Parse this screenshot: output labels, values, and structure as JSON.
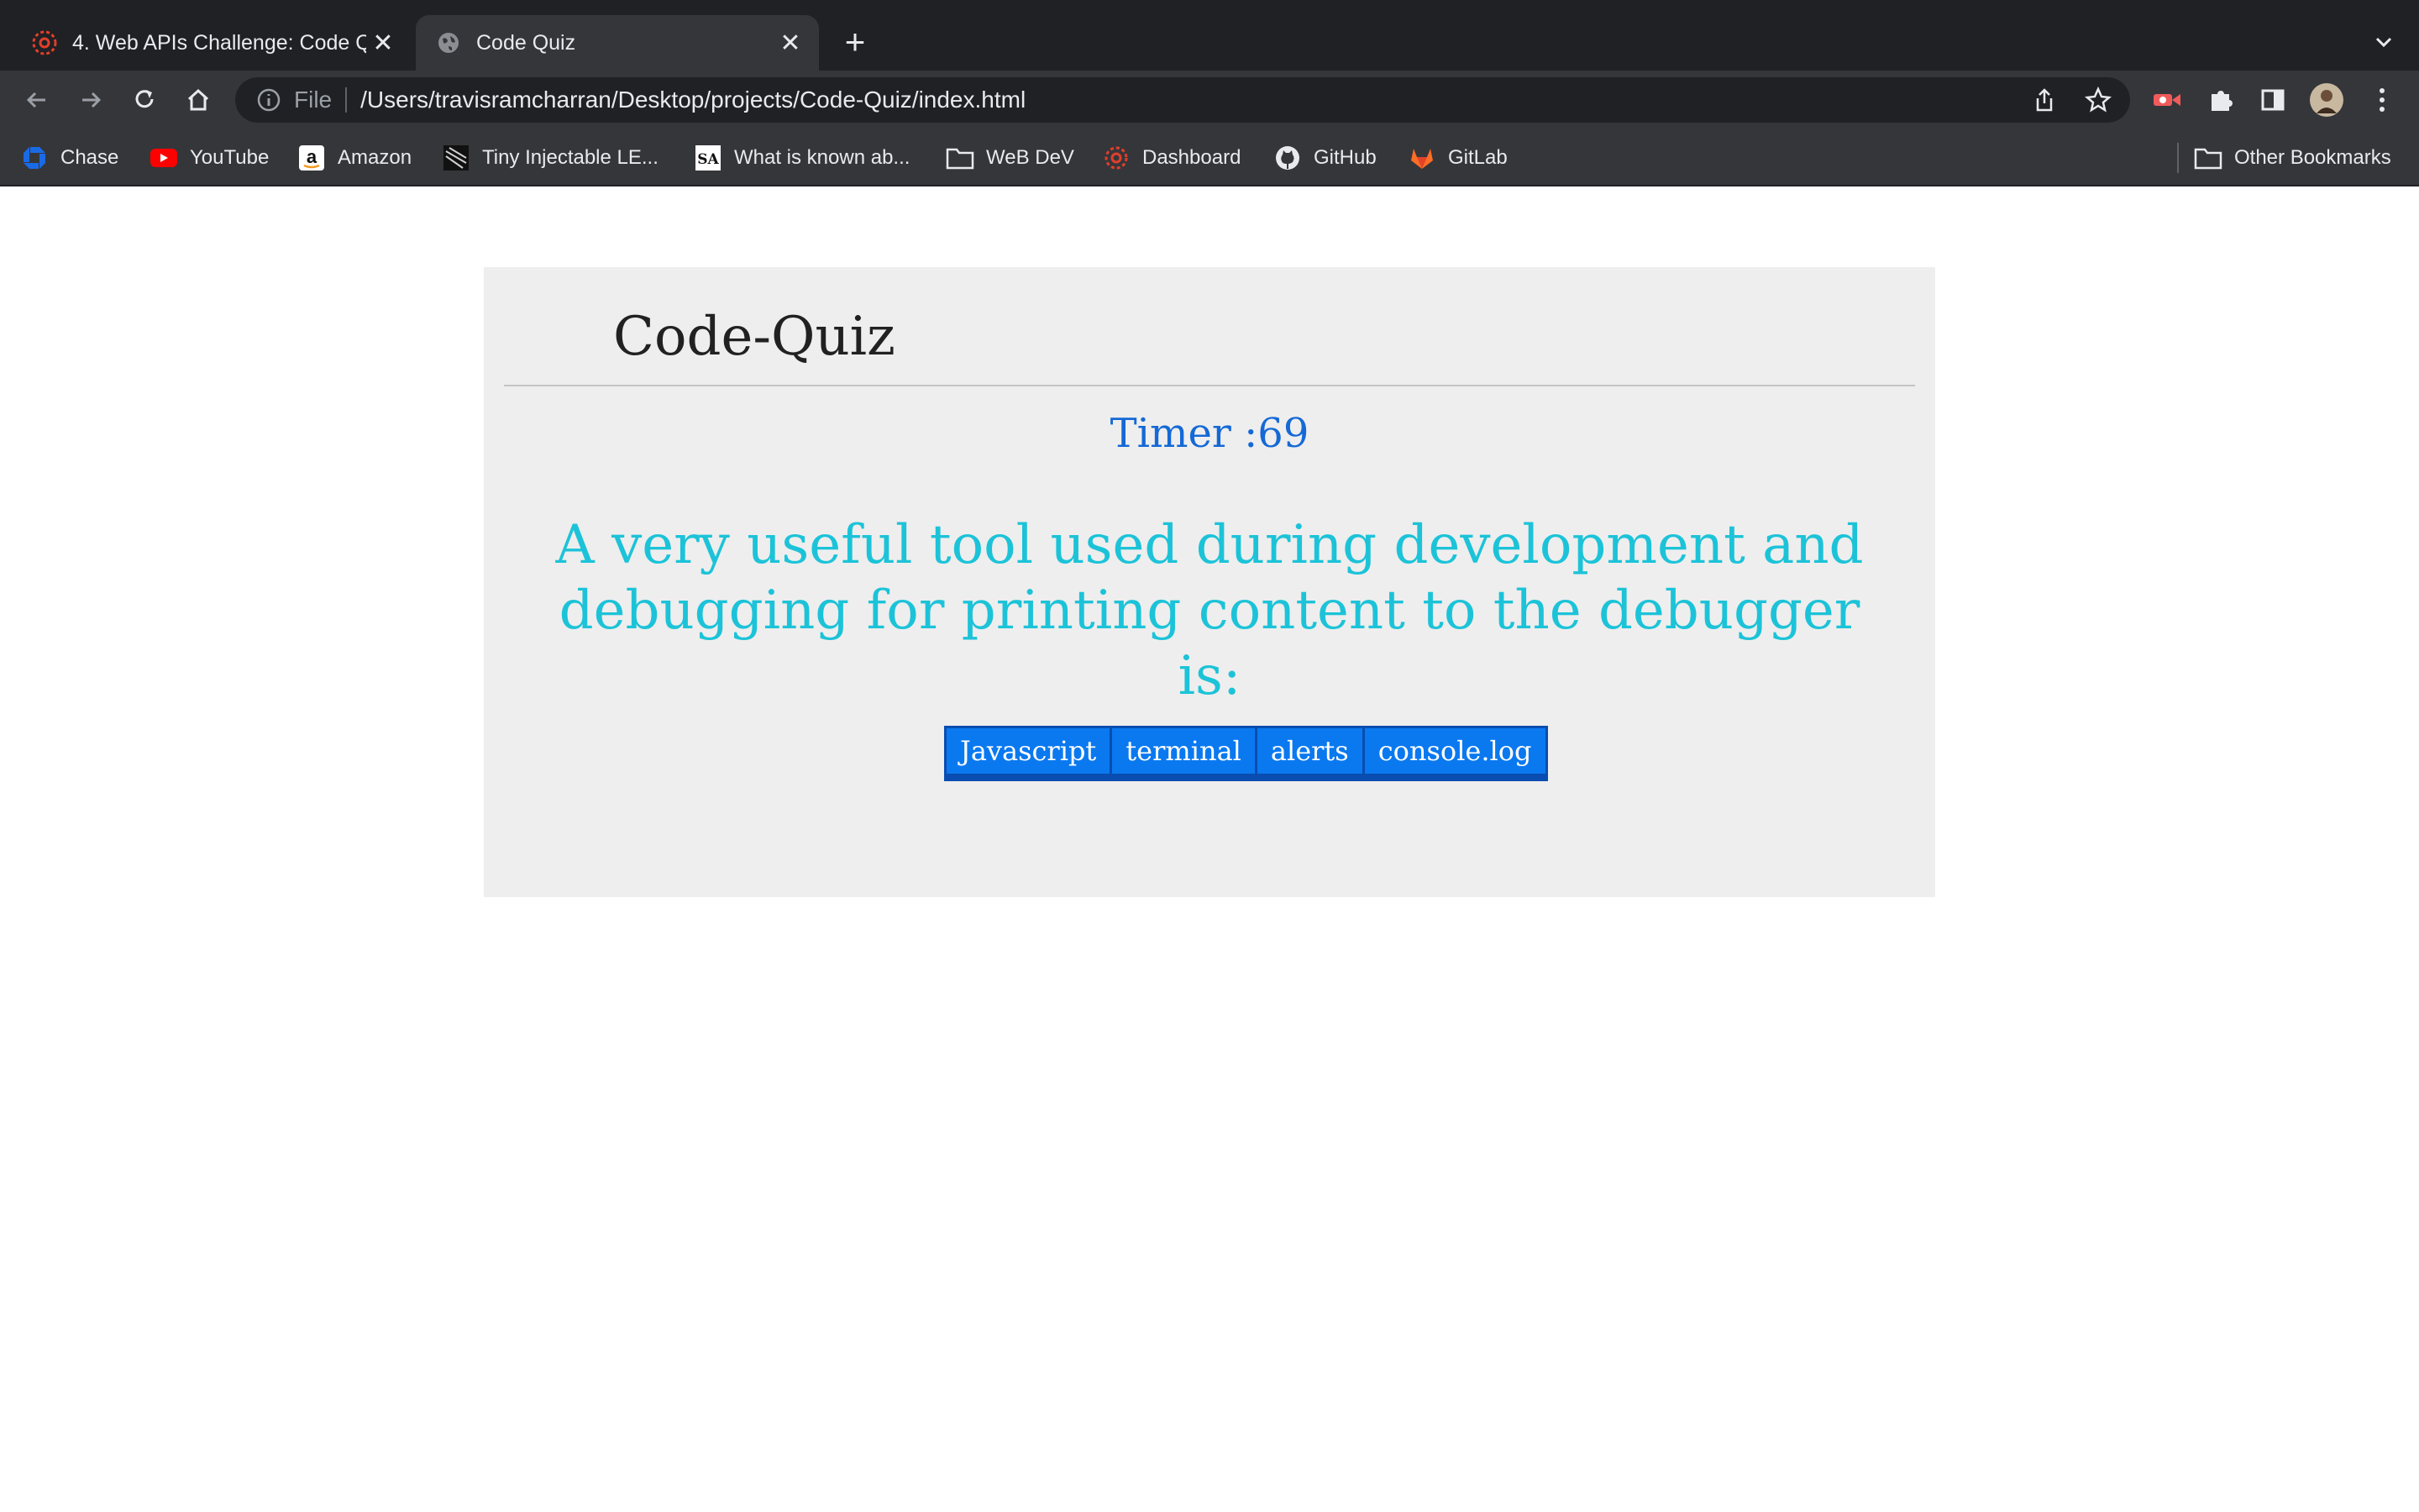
{
  "browser": {
    "tabs": [
      {
        "title": "4. Web APIs Challenge: Code Q",
        "active": false,
        "icon": "canvas-icon"
      },
      {
        "title": "Code Quiz",
        "active": true,
        "icon": "globe-icon"
      }
    ],
    "address_bar": {
      "scheme_label": "File",
      "url": "/Users/travisramcharran/Desktop/projects/Code-Quiz/index.html"
    },
    "bookmarks": [
      {
        "label": "Chase",
        "icon": "chase-icon"
      },
      {
        "label": "YouTube",
        "icon": "youtube-icon"
      },
      {
        "label": "Amazon",
        "icon": "amazon-icon"
      },
      {
        "label": "Tiny Injectable LE...",
        "icon": "site-icon"
      },
      {
        "label": "What is known ab...",
        "icon": "sa-icon"
      },
      {
        "label": "WeB DeV",
        "icon": "folder-icon"
      },
      {
        "label": "Dashboard",
        "icon": "canvas-icon"
      },
      {
        "label": "GitHub",
        "icon": "github-icon"
      },
      {
        "label": "GitLab",
        "icon": "gitlab-icon"
      }
    ],
    "other_bookmarks": "Other Bookmarks"
  },
  "quiz": {
    "title": "Code-Quiz",
    "timer_label": "Timer :",
    "timer_value": "69",
    "question": "A very useful tool used during development and debugging for printing content to the debugger is:",
    "answers": [
      "Javascript",
      "terminal",
      "alerts",
      "console.log"
    ]
  },
  "colors": {
    "card_background": "#eeeeee",
    "timer_text": "#1469d6",
    "question_text": "#1cc3d8",
    "answer_button": "#0a79f0"
  }
}
